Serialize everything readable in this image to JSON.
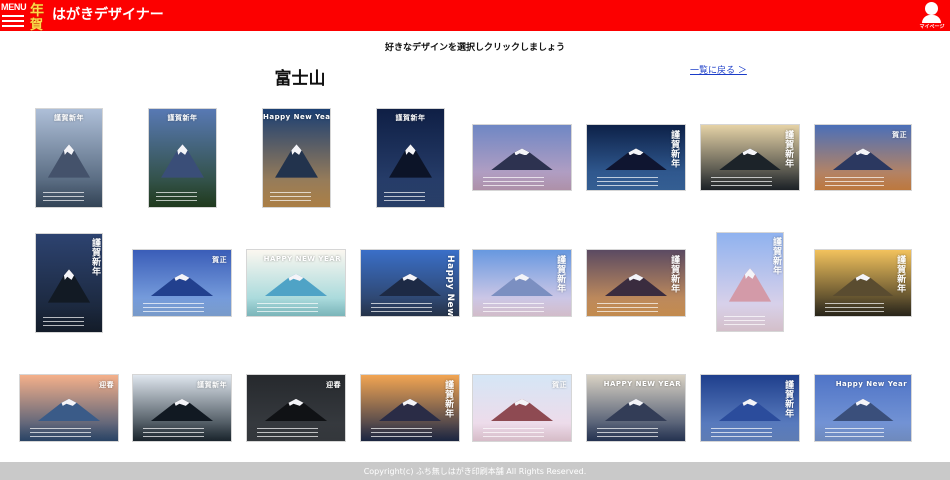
{
  "header": {
    "menu_label": "MENU",
    "logo_top": "年",
    "logo_bottom": "賀",
    "app_title": "はがきデザイナー",
    "mypage_label": "マイページ"
  },
  "main": {
    "instruction": "好きなデザインを選択しクリックしましょう",
    "category_title": "富士山",
    "back_link": "一覧に戻る ＞"
  },
  "designs": [
    {
      "caption": "謹賀新年",
      "top": "#aebfd8",
      "bottom": "#3b4e63",
      "mountain": "#44526b",
      "orientation": "portrait",
      "vertical": false
    },
    {
      "caption": "謹賀新年",
      "top": "#5879b4",
      "bottom": "#254322",
      "mountain": "#3a4e78",
      "orientation": "portrait",
      "vertical": false
    },
    {
      "caption": "Happy New Year",
      "top": "#1b3f73",
      "bottom": "#c49250",
      "mountain": "#22334d",
      "orientation": "portrait",
      "vertical": false
    },
    {
      "caption": "謹賀新年",
      "top": "#0f1f45",
      "bottom": "#2e4776",
      "mountain": "#0c1428",
      "orientation": "portrait",
      "vertical": false
    },
    {
      "caption": "",
      "top": "#6f87c4",
      "bottom": "#c8a6c2",
      "mountain": "#2d3250",
      "orientation": "landscape",
      "vertical": false
    },
    {
      "caption": "謹賀新年",
      "top": "#0d2148",
      "bottom": "#3c6ca8",
      "mountain": "#0f1530",
      "orientation": "landscape",
      "vertical": true
    },
    {
      "caption": "謹賀新年",
      "top": "#e5d2a6",
      "bottom": "#20262c",
      "mountain": "#1c2329",
      "orientation": "landscape",
      "vertical": true
    },
    {
      "caption": "賀正",
      "top": "#4b6fb8",
      "bottom": "#d98a47",
      "mountain": "#2b3860",
      "orientation": "landscape",
      "vertical": false
    },
    {
      "caption": "謹賀新年",
      "top": "#2d4370",
      "bottom": "#16202f",
      "mountain": "#121a24",
      "orientation": "portrait",
      "vertical": true
    },
    {
      "caption": "賀正",
      "top": "#3a5db8",
      "bottom": "#8bb2e8",
      "mountain": "#22408e",
      "orientation": "landscape",
      "vertical": false
    },
    {
      "caption": "HAPPY NEW YEAR",
      "top": "#fbf7f0",
      "bottom": "#8dd0d5",
      "mountain": "#4fa3c6",
      "orientation": "landscape",
      "vertical": false
    },
    {
      "caption": "Happy New Year",
      "top": "#3a6fc8",
      "bottom": "#2b3a54",
      "mountain": "#1d2a45",
      "orientation": "landscape",
      "vertical": true
    },
    {
      "caption": "謹賀新年",
      "top": "#6798e0",
      "bottom": "#f1d8e8",
      "mountain": "#7b8fc1",
      "orientation": "landscape",
      "vertical": true
    },
    {
      "caption": "謹賀新年",
      "top": "#5b4a62",
      "bottom": "#e0a05a",
      "mountain": "#3a2c3f",
      "orientation": "landscape",
      "vertical": true
    },
    {
      "caption": "謹賀新年",
      "top": "#8fb2ef",
      "bottom": "#f3dce8",
      "mountain": "#d39aa8",
      "orientation": "portrait",
      "vertical": true
    },
    {
      "caption": "謹賀新年",
      "top": "#f2c25d",
      "bottom": "#2e2a1e",
      "mountain": "#5a4c30",
      "orientation": "landscape",
      "vertical": true
    },
    {
      "caption": "迎春",
      "top": "#f4b08a",
      "bottom": "#2f4d74",
      "mountain": "#3a5b88",
      "orientation": "landscape",
      "vertical": false
    },
    {
      "caption": "謹賀新年",
      "top": "#dfe6ee",
      "bottom": "#1e2a33",
      "mountain": "#111922",
      "orientation": "landscape",
      "vertical": false
    },
    {
      "caption": "迎春",
      "top": "#26292d",
      "bottom": "#3b3f44",
      "mountain": "#101215",
      "orientation": "landscape",
      "vertical": false
    },
    {
      "caption": "謹賀新年",
      "top": "#f2a552",
      "bottom": "#1e2a4a",
      "mountain": "#2a2c46",
      "orientation": "landscape",
      "vertical": true
    },
    {
      "caption": "賀正",
      "top": "#d5e6f6",
      "bottom": "#f6d8e6",
      "mountain": "#8e4a52",
      "orientation": "landscape",
      "vertical": false
    },
    {
      "caption": "HAPPY NEW YEAR",
      "top": "#d9d2c4",
      "bottom": "#2a3a5c",
      "mountain": "#333d57",
      "orientation": "landscape",
      "vertical": false
    },
    {
      "caption": "謹賀新年",
      "top": "#1f3f8c",
      "bottom": "#6c8fcf",
      "mountain": "#2b4c9c",
      "orientation": "landscape",
      "vertical": true
    },
    {
      "caption": "Happy New Year",
      "top": "#4f74c7",
      "bottom": "#7f9ed9",
      "mountain": "#3a4f7b",
      "orientation": "landscape",
      "vertical": false
    }
  ],
  "footer": {
    "copyright": "Copyright(c) ふち無しはがき印刷本舗 All Rights Reserved."
  }
}
